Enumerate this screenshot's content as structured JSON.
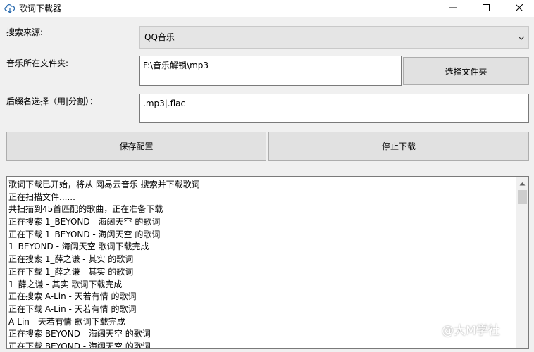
{
  "window": {
    "title": "歌词下載器"
  },
  "form": {
    "search_source_label": "搜索来源:",
    "search_source_value": "QQ音乐",
    "music_folder_label": "音乐所在文件夹:",
    "music_folder_value": "F:\\音乐解锁\\mp3",
    "choose_folder_label": "选择文件夹",
    "suffix_label": "后缀名选择（用|分割）：",
    "suffix_value": ".mp3|.flac",
    "save_config_label": "保存配置",
    "stop_download_label": "停止下载"
  },
  "log": {
    "lines": [
      "歌词下载已开始，将从 网易云音乐 搜索并下载歌词",
      "正在扫描文件......",
      "共扫描到45首匹配的歌曲，正在准备下载",
      "正在搜索 1_BEYOND - 海阔天空 的歌词",
      "正在下载 1_BEYOND - 海阔天空 的歌词",
      "1_BEYOND - 海阔天空 歌词下载完成",
      "正在搜索 1_薛之谦 - 其实 的歌词",
      "正在下载 1_薛之谦 - 其实 的歌词",
      "1_薛之谦 - 其实 歌词下载完成",
      "正在搜索 A-Lin - 天若有情 的歌词",
      "正在下载 A-Lin - 天若有情 的歌词",
      "A-Lin - 天若有情 歌词下载完成",
      "正在搜索 BEYOND - 海阔天空 的歌词",
      "正在下载 BEYOND - 海阔天空 的歌词"
    ]
  },
  "watermark": {
    "text": "@大M学社"
  },
  "icons": {
    "app": "cloud-download-icon",
    "minimize": "minimize-icon",
    "maximize": "maximize-icon",
    "close": "close-icon",
    "dropdown": "chevron-down-icon",
    "scroll_up": "scroll-up-arrow-icon"
  }
}
